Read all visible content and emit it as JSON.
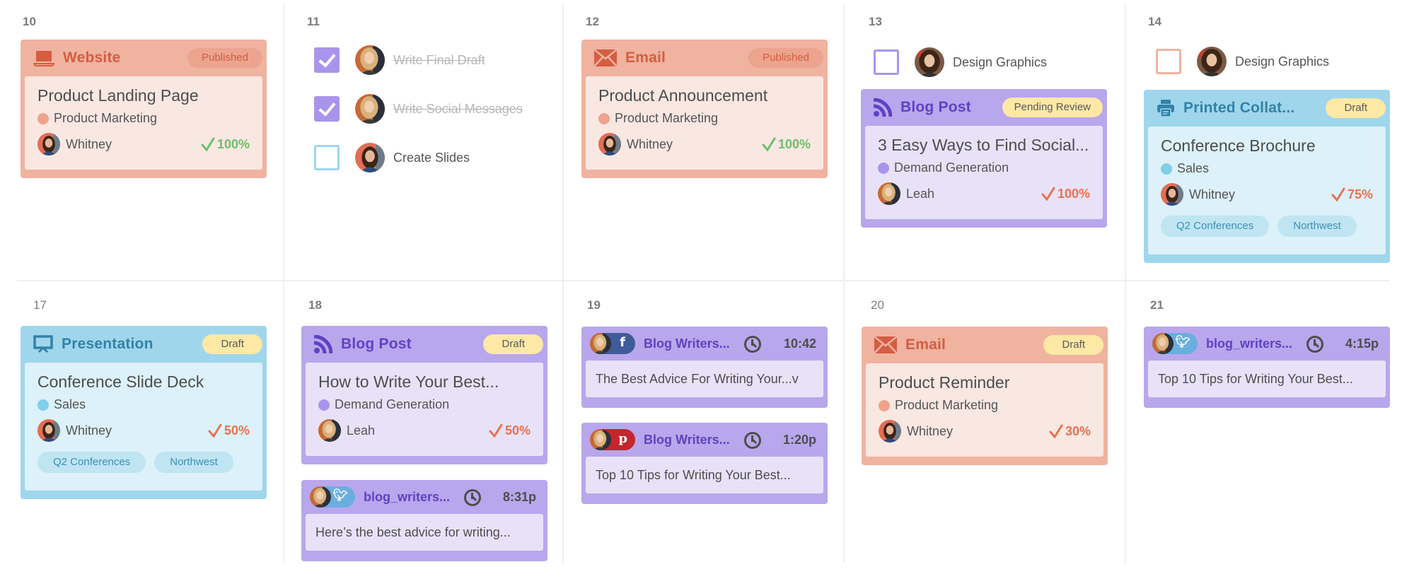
{
  "colors": {
    "orange_accent": "#d45d42",
    "purple_accent": "#5c43c4",
    "blue_accent": "#3382a8",
    "progress_complete": "#6cbf6c",
    "progress_incomplete": "#e8734f",
    "badge_draft": "#fde8a6"
  },
  "days": [
    {
      "num": "10",
      "cards": [
        {
          "type": "Website",
          "icon": "laptop-icon",
          "status": "Published",
          "title": "Product Landing Page",
          "team": "Product Marketing",
          "owner": "Whitney",
          "progress": "100%"
        }
      ]
    },
    {
      "num": "11",
      "tasks": [
        {
          "label": "Write Final Draft",
          "done": true,
          "assignee": "Leah"
        },
        {
          "label": "Write Social Messages",
          "done": true,
          "assignee": "Leah"
        },
        {
          "label": "Create Slides",
          "done": false,
          "assignee": "Whitney"
        }
      ]
    },
    {
      "num": "12",
      "cards": [
        {
          "type": "Email",
          "icon": "envelope-icon",
          "status": "Published",
          "title": "Product Announcement",
          "team": "Product Marketing",
          "owner": "Whitney",
          "progress": "100%"
        }
      ]
    },
    {
      "num": "13",
      "tasks": [
        {
          "label": "Design Graphics",
          "done": false,
          "assignee": "Designer"
        }
      ],
      "cards": [
        {
          "type": "Blog Post",
          "icon": "rss-icon",
          "status": "Pending Review",
          "title": "3 Easy Ways to Find Social...",
          "team": "Demand Generation",
          "owner": "Leah",
          "progress": "100%"
        }
      ]
    },
    {
      "num": "14",
      "tasks": [
        {
          "label": "Design Graphics",
          "done": false,
          "assignee": "Designer"
        }
      ],
      "cards": [
        {
          "type": "Printed Collat...",
          "icon": "printer-icon",
          "status": "Draft",
          "title": "Conference Brochure",
          "team": "Sales",
          "owner": "Whitney",
          "progress": "75%",
          "tags": [
            "Q2 Conferences",
            "Northwest"
          ]
        }
      ]
    },
    {
      "num": "17",
      "cards": [
        {
          "type": "Presentation",
          "icon": "presentation-icon",
          "status": "Draft",
          "title": "Conference Slide Deck",
          "team": "Sales",
          "owner": "Whitney",
          "progress": "50%",
          "tags": [
            "Q2 Conferences",
            "Northwest"
          ]
        }
      ]
    },
    {
      "num": "18",
      "cards": [
        {
          "type": "Blog Post",
          "icon": "rss-icon",
          "status": "Draft",
          "title": "How to Write Your Best...",
          "team": "Demand Generation",
          "owner": "Leah",
          "progress": "50%"
        }
      ],
      "social": [
        {
          "network": "twitter",
          "account": "blog_writers...",
          "time": "8:31p",
          "text": "Here’s the best advice for writing..."
        }
      ]
    },
    {
      "num": "19",
      "social": [
        {
          "network": "facebook",
          "account": "Blog Writers...",
          "time": "10:42",
          "text": "The Best Advice For Writing Your...v"
        },
        {
          "network": "pinterest",
          "account": "Blog Writers...",
          "time": "1:20p",
          "text": "Top 10 Tips for Writing Your Best..."
        }
      ]
    },
    {
      "num": "20",
      "cards": [
        {
          "type": "Email",
          "icon": "envelope-icon",
          "status": "Draft",
          "title": "Product Reminder",
          "team": "Product Marketing",
          "owner": "Whitney",
          "progress": "30%"
        }
      ]
    },
    {
      "num": "21",
      "social": [
        {
          "network": "twitter",
          "account": "blog_writers...",
          "time": "4:15p",
          "text": "Top 10 Tips for Writing Your Best..."
        }
      ]
    }
  ]
}
